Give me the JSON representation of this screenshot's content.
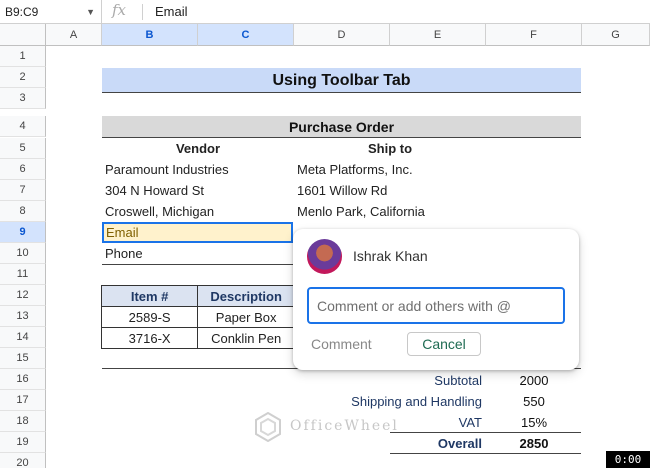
{
  "formula_bar": {
    "name_box": "B9:C9",
    "fx": "fx",
    "value": "Email"
  },
  "columns": [
    "A",
    "B",
    "C",
    "D",
    "E",
    "F",
    "G"
  ],
  "rows": [
    "1",
    "2",
    "3",
    "4",
    "5",
    "6",
    "7",
    "8",
    "9",
    "10",
    "11",
    "12",
    "13",
    "14",
    "15",
    "16",
    "17",
    "18",
    "19",
    "20"
  ],
  "sheet": {
    "title": "Using Toolbar Tab",
    "po_title": "Purchase Order",
    "vendor_header": "Vendor",
    "shipto_header": "Ship to",
    "vendor": [
      "Paramount Industries",
      "304 N Howard St",
      "Croswell, Michigan",
      "Email",
      "Phone"
    ],
    "shipto": [
      "Meta Platforms, Inc.",
      "1601 Willow Rd",
      "Menlo Park, California"
    ],
    "items_table": {
      "headers": [
        "Item #",
        "Description"
      ],
      "rows": [
        [
          "2589-S",
          "Paper Box"
        ],
        [
          "3716-X",
          "Conklin Pen"
        ]
      ]
    },
    "summary": [
      {
        "label": "Subtotal",
        "value": "2000"
      },
      {
        "label": "Shipping and Handling",
        "value": "550"
      },
      {
        "label": "VAT",
        "value": "15%"
      },
      {
        "label": "Overall",
        "value": "2850"
      }
    ]
  },
  "comment": {
    "user": "Ishrak Khan",
    "placeholder": "Comment or add others with @",
    "comment_button": "Comment",
    "cancel_button": "Cancel"
  },
  "watermark": "OfficeWheel",
  "timer": "0:00"
}
